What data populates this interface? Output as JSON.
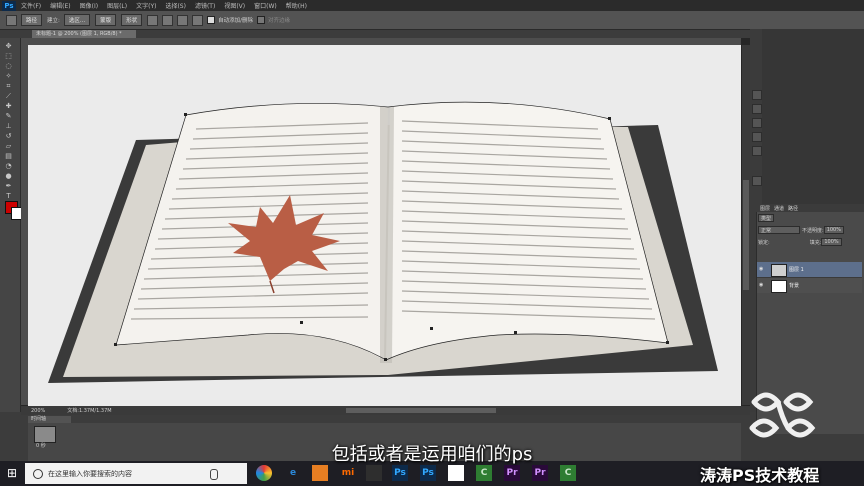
{
  "app": {
    "logo": "Ps"
  },
  "menu": [
    "文件(F)",
    "编辑(E)",
    "图像(I)",
    "图层(L)",
    "文字(Y)",
    "选择(S)",
    "滤镜(T)",
    "视图(V)",
    "窗口(W)",
    "帮助(H)"
  ],
  "options": {
    "mode1": "路径",
    "label_make": "建立:",
    "select_btn": "选区...",
    "mask_btn": "蒙版",
    "shape_btn": "形状",
    "auto_add_delete": "自动添加/删除",
    "align_edges": "对齐边缘"
  },
  "document": {
    "tab": "未标题-1 @ 200% (图层 1, RGB/8) *"
  },
  "status": {
    "zoom": "200%",
    "doc": "文档:1.37M/1.37M"
  },
  "timeline": {
    "tab": "时间轴",
    "frame_time": "0 秒"
  },
  "layers": {
    "tabs": [
      "图层",
      "通道",
      "路径"
    ],
    "kind": "类型",
    "blend": "正常",
    "opacity_label": "不透明度:",
    "opacity": "100%",
    "lock_label": "锁定:",
    "fill_label": "填充:",
    "fill": "100%",
    "items": [
      {
        "name": "图层 1",
        "selected": true
      },
      {
        "name": "背景",
        "selected": false
      }
    ]
  },
  "taskbar": {
    "search_placeholder": "在这里输入你要搜索的内容"
  },
  "overlay": {
    "subtitle": "包括或者是运用咱们的ps",
    "watermark": "涛涛PS技术教程"
  }
}
